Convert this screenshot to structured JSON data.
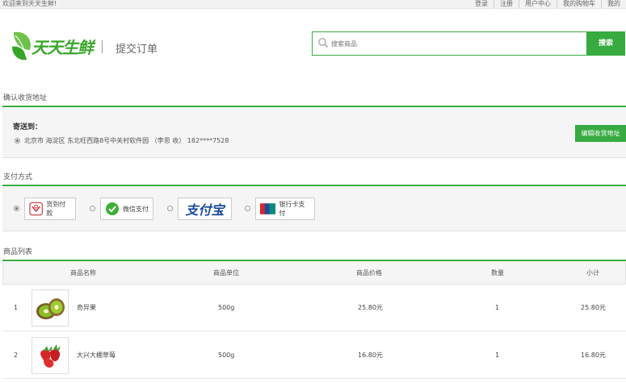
{
  "topbar": {
    "welcome": "欢迎来到天天生鲜!",
    "links": [
      "登录",
      "注册",
      "用户中心",
      "我的购物车",
      "我的"
    ]
  },
  "brand": {
    "name": "天天生鲜",
    "color": "#37a628"
  },
  "page_title": "提交订单",
  "search": {
    "placeholder": "搜索商品",
    "button": "搜索"
  },
  "address": {
    "section_title": "确认收货地址",
    "to_label": "寄送到：",
    "line": "北京市 海淀区 东北旺西路8号中关村软件园 （李思 收） 182****7528",
    "edit_button": "编辑收货地址"
  },
  "payment": {
    "section_title": "支付方式",
    "options": [
      {
        "label": "货到付款",
        "icon": "cash-on-delivery-icon",
        "selected": true
      },
      {
        "label": "微信支付",
        "icon": "wechat-pay-icon",
        "selected": false
      },
      {
        "label": "支付宝",
        "icon": "alipay-logo",
        "selected": false
      },
      {
        "label": "银行卡支付",
        "icon": "unionpay-icon",
        "selected": false
      }
    ]
  },
  "products": {
    "section_title": "商品列表",
    "columns": [
      "商品名称",
      "商品单位",
      "商品价格",
      "数量",
      "小计"
    ],
    "rows": [
      {
        "index": "1",
        "name": "奇异果",
        "unit": "500g",
        "price": "25.80元",
        "qty": "1",
        "subtotal": "25.80元",
        "image": "kiwi-image"
      },
      {
        "index": "2",
        "name": "大兴大棚草莓",
        "unit": "500g",
        "price": "16.80元",
        "qty": "1",
        "subtotal": "16.80元",
        "image": "strawberry-image"
      }
    ]
  },
  "colors": {
    "accent": "#37ab40",
    "panel": "#f5f5f5"
  }
}
